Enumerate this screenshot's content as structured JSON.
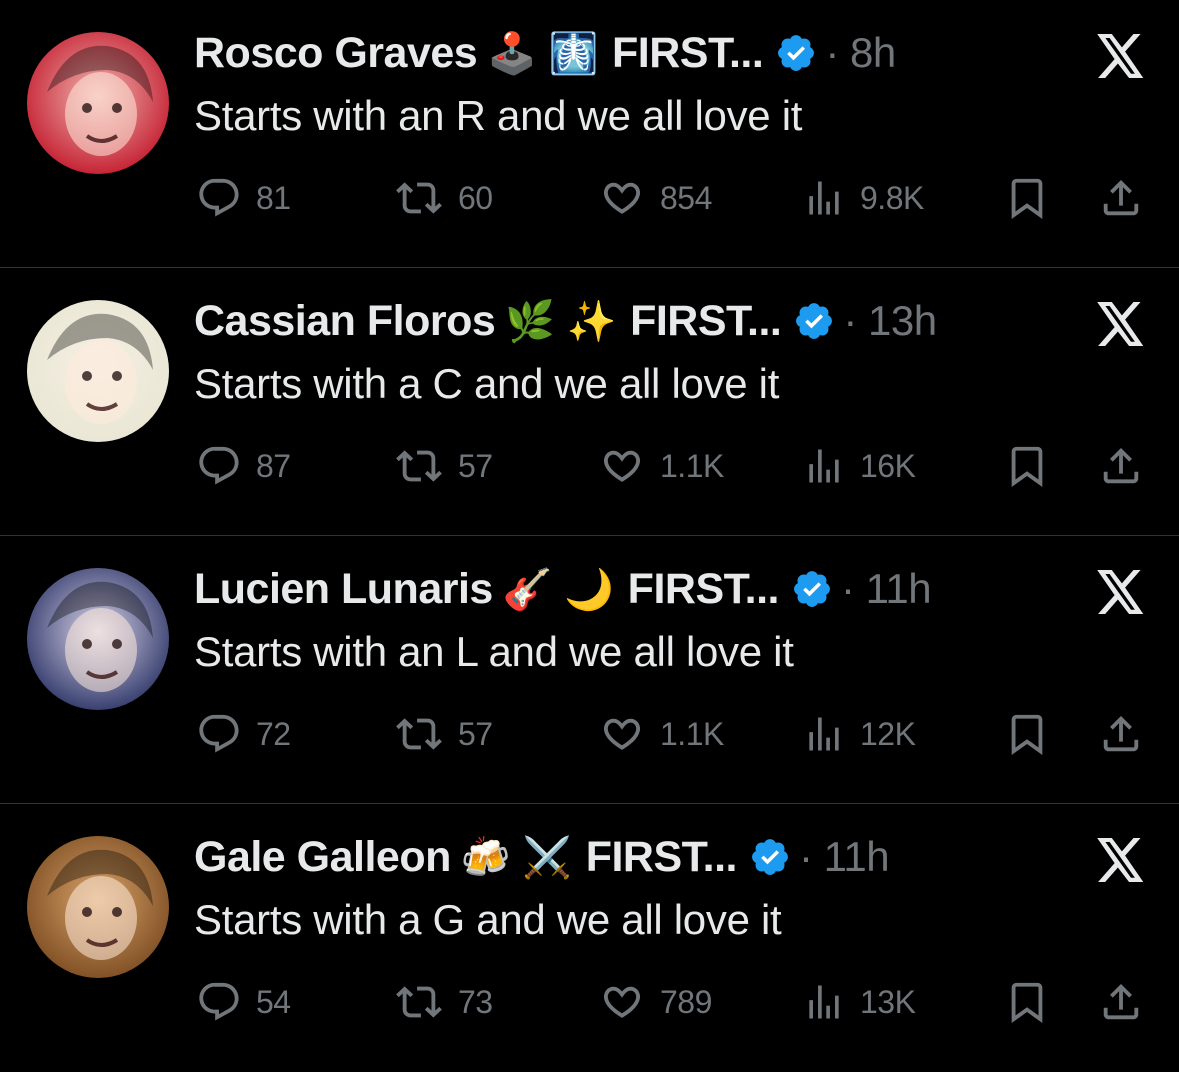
{
  "tweets": [
    {
      "name": "Rosco Graves",
      "emojis": "🕹️ 🩻",
      "org": "FIRST...",
      "time": "· 8h",
      "text": "Starts with an R and we all love it",
      "replies": "81",
      "reposts": "60",
      "likes": "854",
      "views": "9.8K",
      "avatar_colors": [
        "#c2182b",
        "#f0b5b0"
      ]
    },
    {
      "name": "Cassian Floros",
      "emojis": "🌿 ✨",
      "org": "FIRST...",
      "time": "· 13h",
      "text": "Starts with a C and we all love it",
      "replies": "87",
      "reposts": "57",
      "likes": "1.1K",
      "views": "16K",
      "avatar_colors": [
        "#e9e6d4",
        "#f5efe2"
      ]
    },
    {
      "name": "Lucien Lunaris",
      "emojis": "🎸 🌙",
      "org": "FIRST...",
      "time": "· 11h",
      "text": "Starts with an L and we all love it",
      "replies": "72",
      "reposts": "57",
      "likes": "1.1K",
      "views": "12K",
      "avatar_colors": [
        "#2b3466",
        "#d8d2e8"
      ]
    },
    {
      "name": "Gale Galleon",
      "emojis": "🍻 ⚔️",
      "org": "FIRST...",
      "time": "· 11h",
      "text": "Starts with a G and we all love it",
      "replies": "54",
      "reposts": "73",
      "likes": "789",
      "views": "13K",
      "avatar_colors": [
        "#7a4a20",
        "#d9a46a"
      ]
    }
  ],
  "icons": {
    "reply": "reply-icon",
    "repost": "repost-icon",
    "like": "like-icon",
    "views": "views-icon",
    "bookmark": "bookmark-icon",
    "share": "share-icon",
    "verified": "verified-badge-icon",
    "xlogo": "x-logo-icon"
  },
  "colors": {
    "background": "#000000",
    "text": "#e7e9ea",
    "muted": "#71767b",
    "verified": "#1d9bf0",
    "divider": "#2f3336"
  }
}
